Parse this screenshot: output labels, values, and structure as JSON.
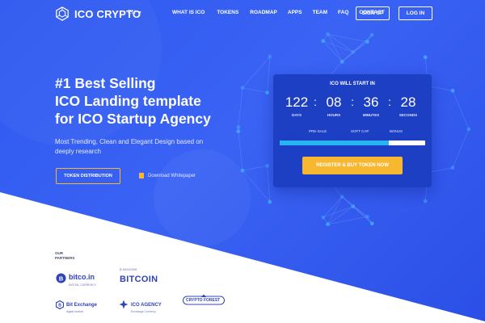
{
  "colors": {
    "hero": "#2f59f0",
    "accent": "#f7b731",
    "card": "#1d3fc4",
    "progress": "#27b4f0",
    "partner": "#3044b8"
  },
  "header": {
    "logo_text": "ICO CRYPTO",
    "lang": "EN",
    "nav": [
      "WHAT IS ICO",
      "TOKENS",
      "ROADMAP",
      "APPS",
      "TEAM",
      "FAQ",
      "CONTACT"
    ],
    "signup": "SIGN UP",
    "login": "LOG IN"
  },
  "hero": {
    "headline": [
      "#1 Best Selling",
      "ICO Landing template",
      "for ICO Startup Agency"
    ],
    "subtext": "Most Trending, Clean and Elegant Design based on deeply research",
    "token_button": "TOKEN DISTRIBUTION",
    "whitepaper": "Download Whitepaper"
  },
  "countdown": {
    "title": "ICO WILL START IN",
    "units": [
      {
        "value": "122",
        "label": "DAYS"
      },
      {
        "value": "08",
        "label": "HOURS"
      },
      {
        "value": "36",
        "label": "MINUTES"
      },
      {
        "value": "28",
        "label": "SECONDS"
      }
    ],
    "milestones": [
      "PRE-SALE",
      "SOFT CAP",
      "BONUS"
    ],
    "progress": 0.75,
    "buy_button": "REGISTER & BUY TOKEN NOW"
  },
  "partners": {
    "title": [
      "OUR",
      "PARTNERS"
    ],
    "items": [
      {
        "name": "bitco.in",
        "sub": "DIGITAL CURRENCY"
      },
      {
        "name": "BITCOIN",
        "sub": "₿ MAGAZINE"
      },
      {
        "name": "Bit Exchange",
        "sub": "digital market"
      },
      {
        "name": "ICO AGENCY",
        "sub": "Exchange Currency"
      },
      {
        "name": "CRYPTO FOREST",
        "sub": ""
      }
    ]
  }
}
